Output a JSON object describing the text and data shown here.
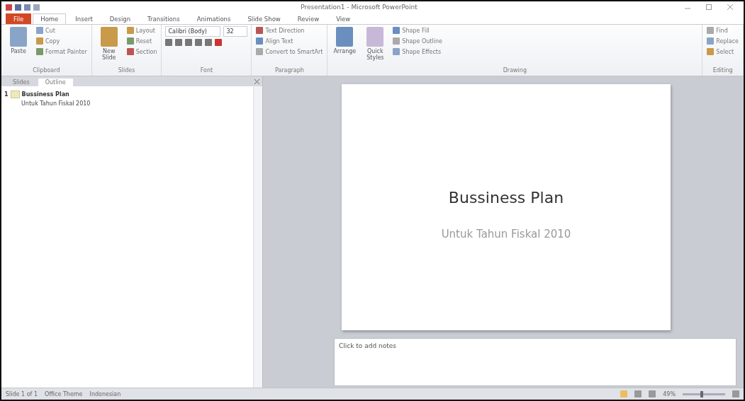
{
  "window": {
    "title": "Presentation1 - Microsoft PowerPoint"
  },
  "ribbon_tabs": [
    {
      "label": "File",
      "kind": "file",
      "selected": false
    },
    {
      "label": "Home",
      "kind": "tab",
      "selected": true
    },
    {
      "label": "Insert",
      "kind": "tab",
      "selected": false
    },
    {
      "label": "Design",
      "kind": "tab",
      "selected": false
    },
    {
      "label": "Transitions",
      "kind": "tab",
      "selected": false
    },
    {
      "label": "Animations",
      "kind": "tab",
      "selected": false
    },
    {
      "label": "Slide Show",
      "kind": "tab",
      "selected": false
    },
    {
      "label": "Review",
      "kind": "tab",
      "selected": false
    },
    {
      "label": "View",
      "kind": "tab",
      "selected": false
    }
  ],
  "ribbon_groups": [
    {
      "label": "Clipboard",
      "big": "Paste",
      "small": [
        "Cut",
        "Copy",
        "Format Painter"
      ]
    },
    {
      "label": "Slides",
      "big": "New Slide",
      "small": [
        "Layout",
        "Reset",
        "Section"
      ]
    },
    {
      "label": "Font",
      "font": "Calibri (Body)",
      "size": "32"
    },
    {
      "label": "Paragraph",
      "small": [
        "Text Direction",
        "Align Text",
        "Convert to SmartArt"
      ]
    },
    {
      "label": "Drawing",
      "big": "Arrange",
      "big2": "Quick Styles",
      "small": [
        "Shape Fill",
        "Shape Outline",
        "Shape Effects"
      ]
    },
    {
      "label": "Editing",
      "small": [
        "Find",
        "Replace",
        "Select"
      ]
    }
  ],
  "pane_tabs": [
    {
      "label": "Slides",
      "selected": false
    },
    {
      "label": "Outline",
      "selected": true
    }
  ],
  "outline": [
    {
      "number": "1",
      "title": "Bussiness Plan",
      "subtitle": "Untuk Tahun Fiskal 2010"
    }
  ],
  "slide": {
    "title": "Bussiness Plan",
    "subtitle": "Untuk Tahun Fiskal 2010"
  },
  "notes": {
    "placeholder": "Click to add notes"
  },
  "status_bar": {
    "slide": "Slide 1 of 1",
    "theme": "Office Theme",
    "language": "Indonesian",
    "zoom": "49%",
    "level": 0.45
  }
}
